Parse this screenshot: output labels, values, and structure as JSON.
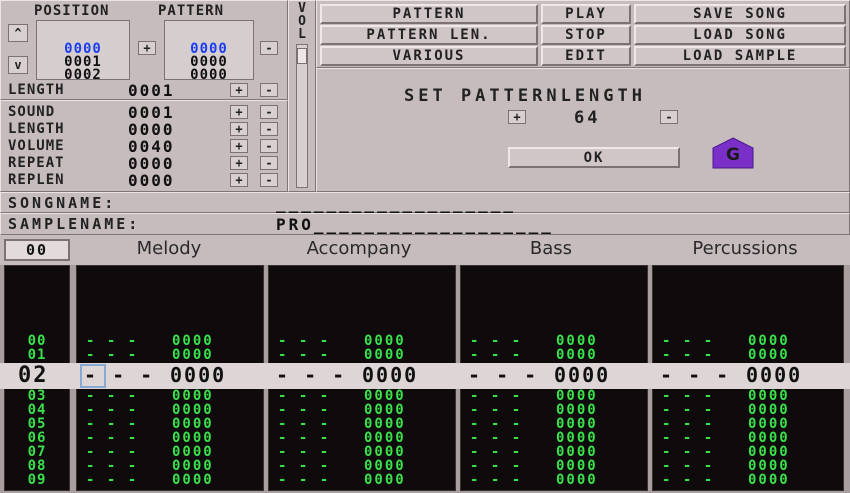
{
  "position_pattern": {
    "position_label": "POSITION",
    "pattern_label": "PATTERN",
    "position_list": [
      "0000",
      "0001",
      "0002"
    ],
    "pattern_list": [
      "0000",
      "0000",
      "0000"
    ],
    "plus": "+",
    "minus": "-",
    "up": "^",
    "down": "v"
  },
  "length": {
    "label": "LENGTH",
    "value": "0001"
  },
  "vol_label": "VOL",
  "sample_params": [
    {
      "label": "SOUND",
      "value": "0001"
    },
    {
      "label": "LENGTH",
      "value": "0000"
    },
    {
      "label": "VOLUME",
      "value": "0040"
    },
    {
      "label": "REPEAT",
      "value": "0000"
    },
    {
      "label": "REPLEN",
      "value": "0000"
    }
  ],
  "menu": {
    "pattern": "PATTERN",
    "play": "PLAY",
    "save_song": "SAVE SONG",
    "pattern_len": "PATTERN LEN.",
    "stop": "STOP",
    "load_song": "LOAD SONG",
    "various": "VARIOUS",
    "edit": "EDIT",
    "load_sample": "LOAD SAMPLE"
  },
  "dialog": {
    "title": "SET PATTERNLENGTH",
    "plus": "+",
    "minus": "-",
    "value": "64",
    "ok": "OK",
    "badge": "G"
  },
  "songname": {
    "label": "SONGNAME:",
    "value": "___________________"
  },
  "samplename": {
    "label": "SAMPLENAME:",
    "value": "PRO___________________"
  },
  "pattern_number": "00",
  "tracks": [
    {
      "name": "Melody"
    },
    {
      "name": "Accompany"
    },
    {
      "name": "Bass"
    },
    {
      "name": "Percussions"
    }
  ],
  "note_row": {
    "note": "- - -",
    "data": "0000"
  },
  "rows_above": [
    "00",
    "01"
  ],
  "current_row": "02",
  "rows_below": [
    "03",
    "04",
    "05",
    "06",
    "07",
    "08",
    "09"
  ],
  "colors": {
    "note_green": "#39e04a",
    "cursor_blue": "#1b3df0",
    "badge_purple": "#7a2fc8"
  }
}
